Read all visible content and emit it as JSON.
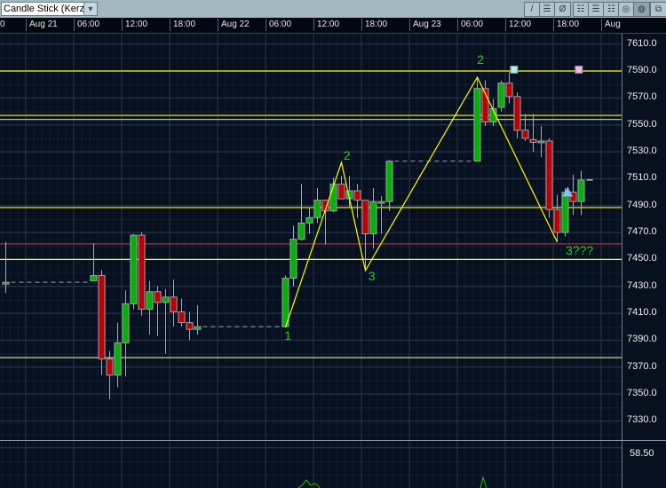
{
  "toolbar": {
    "chart_type": "Candle Stick (Kerze",
    "buttons": [
      {
        "name": "draw-line-button",
        "glyph": "/"
      },
      {
        "name": "horizontal-line-button",
        "glyph": "☰"
      },
      {
        "name": "clear-drawing-button",
        "glyph": "Ø"
      },
      {
        "name": "grid-style-1-button",
        "glyph": "☷"
      },
      {
        "name": "grid-style-2-button",
        "glyph": "☰"
      },
      {
        "name": "grid-style-3-button",
        "glyph": "☷"
      },
      {
        "name": "indicator-a-button",
        "glyph": "◎"
      },
      {
        "name": "indicator-b-button",
        "glyph": "◍"
      },
      {
        "name": "detach-window-button",
        "glyph": "⧉"
      }
    ]
  },
  "time_axis": [
    "0",
    "Aug 21",
    "06:00",
    "12:00",
    "18:00",
    "Aug 22",
    "06:00",
    "12:00",
    "18:00",
    "Aug 23",
    "06:00",
    "12:00",
    "18:00",
    "Aug"
  ],
  "price_axis": [
    "7610.0",
    "7590.0",
    "7570.0",
    "7550.0",
    "7530.0",
    "7510.0",
    "7490.0",
    "7470.0",
    "7450.0",
    "7430.0",
    "7410.0",
    "7390.0",
    "7370.0",
    "7350.0",
    "7330.0"
  ],
  "lower_panel": {
    "label": "58.50"
  },
  "colors": {
    "up": "#00b400",
    "down": "#c00000",
    "level": "#ffff00",
    "zigzag": "#ffff00",
    "label": "#22d022",
    "background": "#07101f"
  },
  "chart_data": {
    "type": "candlestick",
    "x_unit": "hours since Aug 21 00:00",
    "ylim": [
      7310,
      7620
    ],
    "candles": [
      [
        -3,
        7432,
        7463,
        7425,
        7433
      ],
      [
        8,
        7434,
        7462,
        7434,
        7438
      ],
      [
        9,
        7438,
        7442,
        7364,
        7376
      ],
      [
        10,
        7376,
        7382,
        7346,
        7364
      ],
      [
        11,
        7364,
        7403,
        7355,
        7388
      ],
      [
        12,
        7388,
        7427,
        7363,
        7417
      ],
      [
        13,
        7417,
        7469,
        7413,
        7468
      ],
      [
        14,
        7468,
        7470,
        7408,
        7413
      ],
      [
        15,
        7413,
        7434,
        7394,
        7426
      ],
      [
        16,
        7426,
        7430,
        7393,
        7418
      ],
      [
        17,
        7418,
        7428,
        7380,
        7422
      ],
      [
        18,
        7422,
        7435,
        7400,
        7411
      ],
      [
        19,
        7411,
        7421,
        7400,
        7403
      ],
      [
        20,
        7403,
        7411,
        7390,
        7398
      ],
      [
        21,
        7398,
        7416,
        7394,
        7400
      ],
      [
        32,
        7400,
        7438,
        7400,
        7436
      ],
      [
        33,
        7436,
        7475,
        7430,
        7465
      ],
      [
        34,
        7465,
        7506,
        7464,
        7477
      ],
      [
        35,
        7477,
        7489,
        7469,
        7481
      ],
      [
        36,
        7481,
        7503,
        7477,
        7494
      ],
      [
        37,
        7494,
        7494,
        7461,
        7486
      ],
      [
        38,
        7486,
        7511,
        7485,
        7506
      ],
      [
        39,
        7506,
        7512,
        7495,
        7495
      ],
      [
        40,
        7495,
        7512,
        7489,
        7501
      ],
      [
        41,
        7501,
        7506,
        7481,
        7494
      ],
      [
        42,
        7494,
        7494,
        7442,
        7469
      ],
      [
        43,
        7469,
        7503,
        7458,
        7493
      ],
      [
        44,
        7492,
        7497,
        7469,
        7493
      ],
      [
        45,
        7493,
        7524,
        7486,
        7523
      ],
      [
        56,
        7523,
        7585,
        7523,
        7577
      ],
      [
        57,
        7577,
        7583,
        7549,
        7552
      ],
      [
        58,
        7552,
        7569,
        7549,
        7562
      ],
      [
        59,
        7563,
        7583,
        7560,
        7581
      ],
      [
        60,
        7581,
        7589,
        7566,
        7571
      ],
      [
        61,
        7571,
        7574,
        7540,
        7546
      ],
      [
        62,
        7546,
        7558,
        7538,
        7540
      ],
      [
        63,
        7539,
        7558,
        7530,
        7537
      ],
      [
        64,
        7537,
        7549,
        7526,
        7538
      ],
      [
        65,
        7538,
        7540,
        7481,
        7487
      ],
      [
        66,
        7487,
        7498,
        7463,
        7470
      ],
      [
        67,
        7470,
        7503,
        7467,
        7500
      ],
      [
        68,
        7500,
        7513,
        7483,
        7493
      ],
      [
        69,
        7493,
        7516,
        7483,
        7509
      ]
    ],
    "levels": [
      {
        "price": 7590,
        "color": "#ffff00"
      },
      {
        "price": 7557,
        "color": "#ffff00"
      },
      {
        "price": 7554,
        "color": "#8ed08e"
      },
      {
        "price": 7488.5,
        "color": "#ffff00"
      },
      {
        "price": 7461.5,
        "color": "#b03030"
      },
      {
        "price": 7450,
        "color": "#ffff00"
      },
      {
        "price": 7377,
        "color": "#e8e890"
      }
    ],
    "zigzag": [
      [
        32,
        7399.5
      ],
      [
        39,
        7522
      ],
      [
        42,
        7441.7
      ],
      [
        56,
        7585.4
      ],
      [
        66,
        7462.8
      ]
    ],
    "wave_labels": [
      {
        "text": "1",
        "h": 32.3,
        "price": 7393
      },
      {
        "text": "2",
        "h": 39.7,
        "price": 7527
      },
      {
        "text": "3",
        "h": 42.8,
        "price": 7437
      },
      {
        "text": "2",
        "h": 56.4,
        "price": 7598
      },
      {
        "text": "3???",
        "h": 67.5,
        "price": 7456
      }
    ],
    "markers": [
      {
        "type": "square",
        "h": 60.6,
        "price": 7591,
        "color": "#a8f0f8"
      },
      {
        "type": "square",
        "h": 68.7,
        "price": 7591,
        "color": "#ffb0f0"
      },
      {
        "type": "triangle",
        "h": 67.3,
        "price": 7500,
        "color": "#7cc0f0"
      }
    ],
    "last_price": 7509
  }
}
